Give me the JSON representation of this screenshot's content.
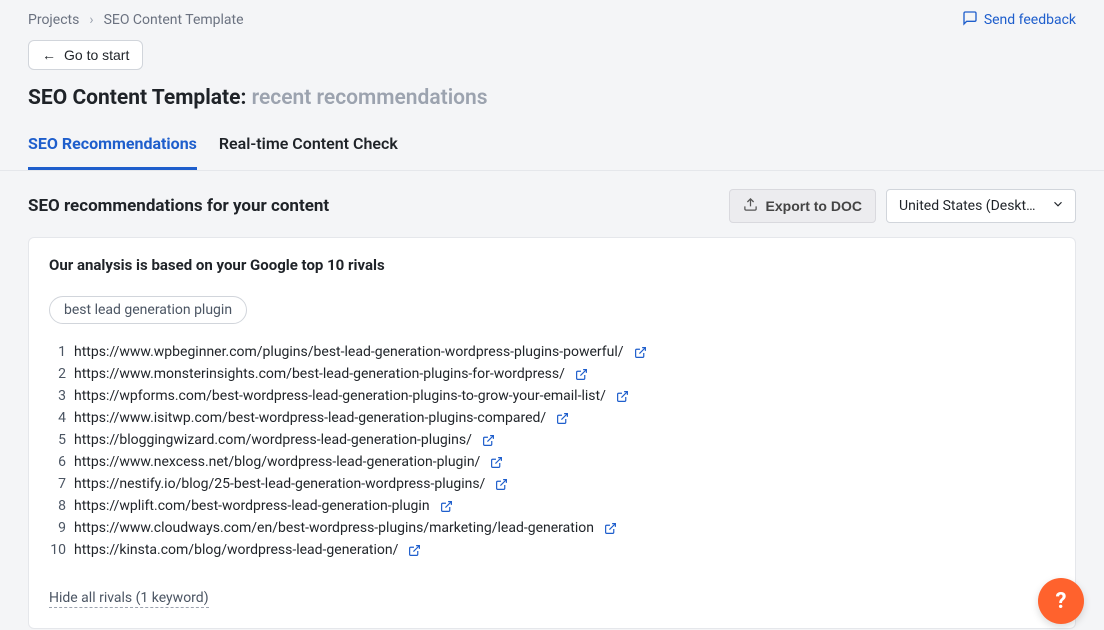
{
  "breadcrumb": {
    "root": "Projects",
    "current": "SEO Content Template"
  },
  "feedback": {
    "label": "Send feedback"
  },
  "go_to_start": {
    "label": "Go to start"
  },
  "page_title": {
    "main": "SEO Content Template:",
    "sub": "recent recommendations"
  },
  "tabs": [
    {
      "label": "SEO Recommendations",
      "active": true
    },
    {
      "label": "Real-time Content Check",
      "active": false
    }
  ],
  "section": {
    "heading": "SEO recommendations for your content",
    "export_label": "Export to DOC",
    "region_label": "United States (Deskt…"
  },
  "card": {
    "title": "Our analysis is based on your Google top 10 rivals",
    "keyword": "best lead generation plugin",
    "rivals": [
      "https://www.wpbeginner.com/plugins/best-lead-generation-wordpress-plugins-powerful/",
      "https://www.monsterinsights.com/best-lead-generation-plugins-for-wordpress/",
      "https://wpforms.com/best-wordpress-lead-generation-plugins-to-grow-your-email-list/",
      "https://www.isitwp.com/best-wordpress-lead-generation-plugins-compared/",
      "https://bloggingwizard.com/wordpress-lead-generation-plugins/",
      "https://www.nexcess.net/blog/wordpress-lead-generation-plugin/",
      "https://nestify.io/blog/25-best-lead-generation-wordpress-plugins/",
      "https://wplift.com/best-wordpress-lead-generation-plugin",
      "https://www.cloudways.com/en/best-wordpress-plugins/marketing/lead-generation",
      "https://kinsta.com/blog/wordpress-lead-generation/"
    ],
    "hide_link": "Hide all rivals (1 keyword)"
  },
  "help_fab": "?"
}
